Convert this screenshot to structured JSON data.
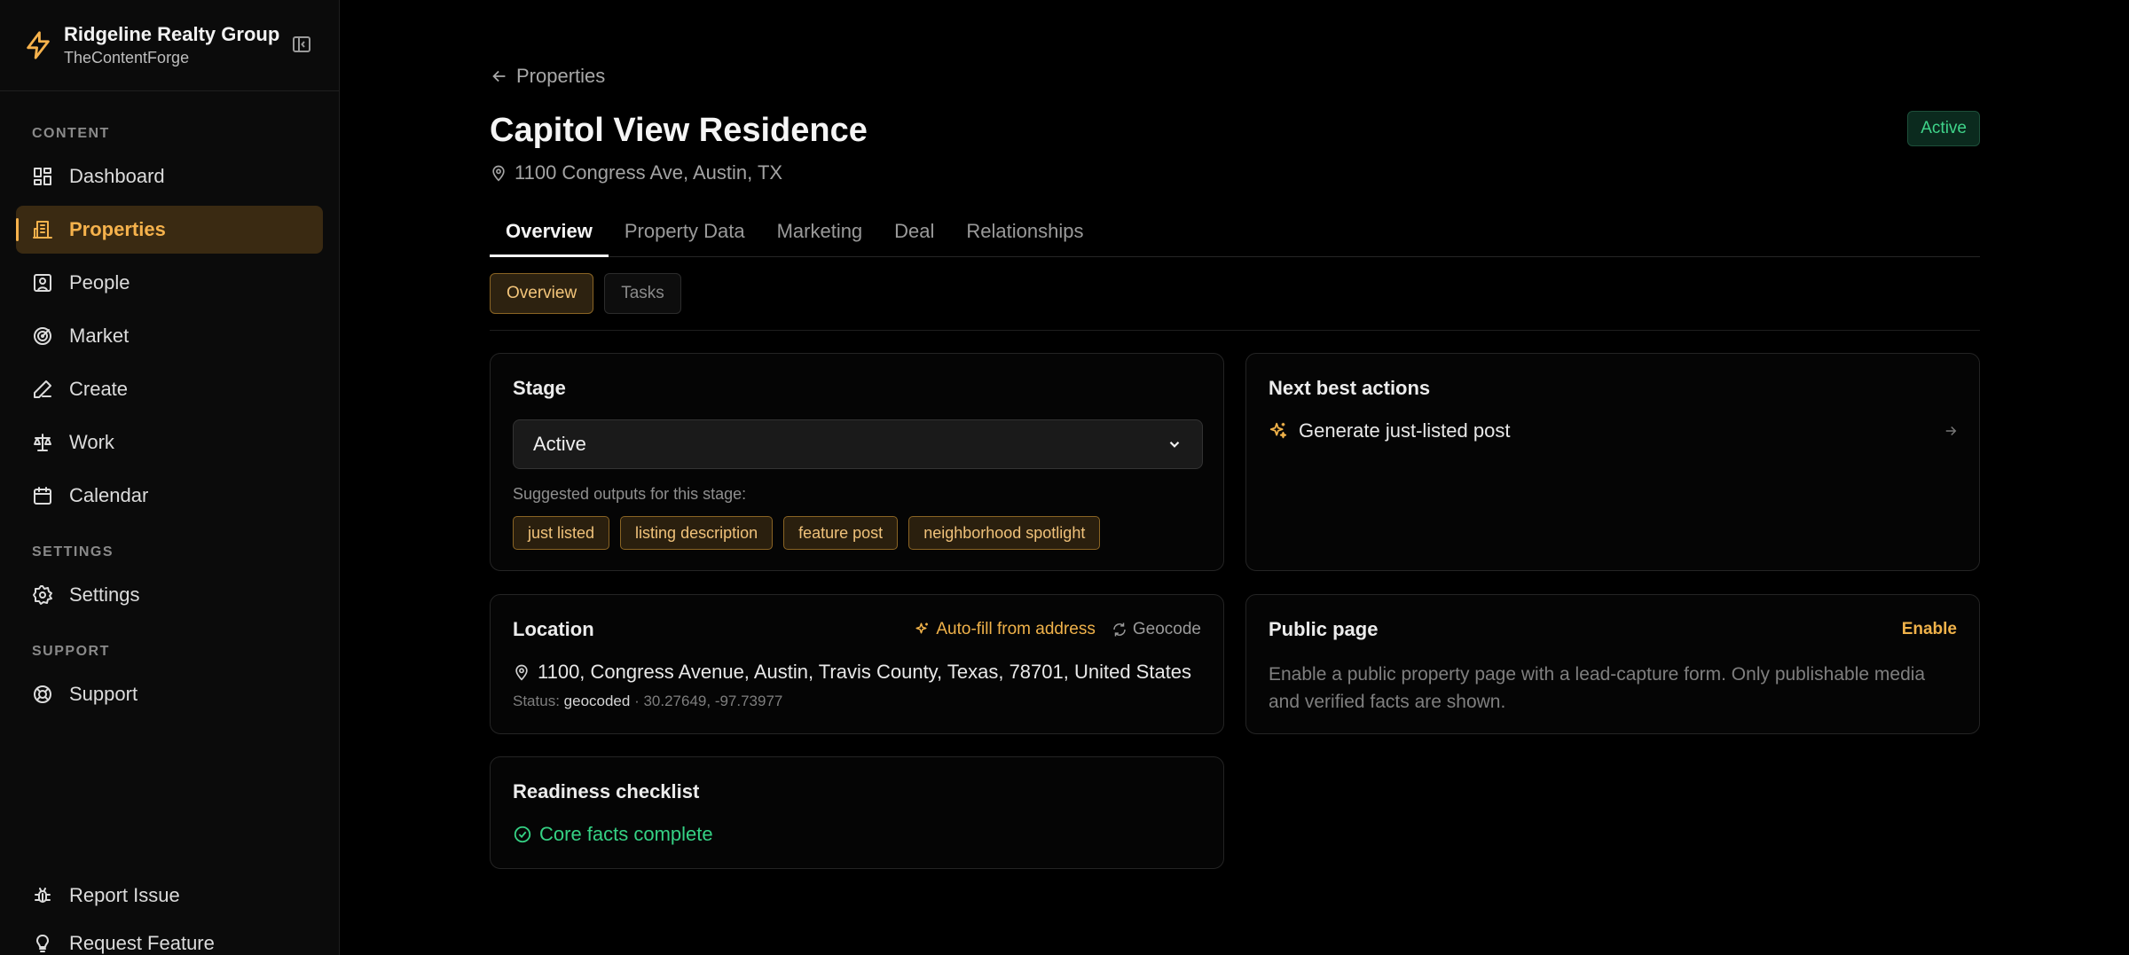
{
  "brand": {
    "name": "Ridgeline Realty Group",
    "workspace": "TheContentForge"
  },
  "sidebar": {
    "sections": [
      {
        "label": "CONTENT",
        "items": [
          {
            "label": "Dashboard",
            "icon": "dashboard-icon"
          },
          {
            "label": "Properties",
            "icon": "building-icon",
            "active": true
          },
          {
            "label": "People",
            "icon": "person-card-icon"
          },
          {
            "label": "Market",
            "icon": "radar-icon"
          },
          {
            "label": "Create",
            "icon": "pen-icon"
          },
          {
            "label": "Work",
            "icon": "scale-icon"
          },
          {
            "label": "Calendar",
            "icon": "calendar-icon"
          }
        ]
      },
      {
        "label": "SETTINGS",
        "items": [
          {
            "label": "Settings",
            "icon": "gear-icon"
          }
        ]
      },
      {
        "label": "SUPPORT",
        "items": [
          {
            "label": "Support",
            "icon": "lifebuoy-icon"
          }
        ]
      }
    ],
    "footer": [
      {
        "label": "Report Issue",
        "icon": "bug-icon"
      },
      {
        "label": "Request Feature",
        "icon": "lightbulb-icon"
      }
    ]
  },
  "header": {
    "back_label": "Properties",
    "title": "Capitol View Residence",
    "address": "1100 Congress Ave, Austin, TX",
    "status": "Active"
  },
  "tabs": [
    "Overview",
    "Property Data",
    "Marketing",
    "Deal",
    "Relationships"
  ],
  "subtabs": [
    "Overview",
    "Tasks"
  ],
  "stage": {
    "title": "Stage",
    "selected": "Active",
    "suggest_label": "Suggested outputs for this stage:",
    "chips": [
      "just listed",
      "listing description",
      "feature post",
      "neighborhood spotlight"
    ]
  },
  "next_actions": {
    "title": "Next best actions",
    "items": [
      "Generate just-listed post"
    ]
  },
  "location": {
    "title": "Location",
    "autofill_label": "Auto-fill from address",
    "geocode_label": "Geocode",
    "full_address": "1100, Congress Avenue, Austin, Travis County, Texas, 78701, United States",
    "status_prefix": "Status:",
    "status_value": "geocoded",
    "coords": "· 30.27649, -97.73977"
  },
  "public_page": {
    "title": "Public page",
    "enable_label": "Enable",
    "description": "Enable a public property page with a lead-capture form. Only publishable media and verified facts are shown."
  },
  "readiness": {
    "title": "Readiness checklist",
    "items": [
      "Core facts complete"
    ]
  },
  "colors": {
    "accent": "#f6b24c",
    "success": "#35d184",
    "background": "#000000"
  }
}
